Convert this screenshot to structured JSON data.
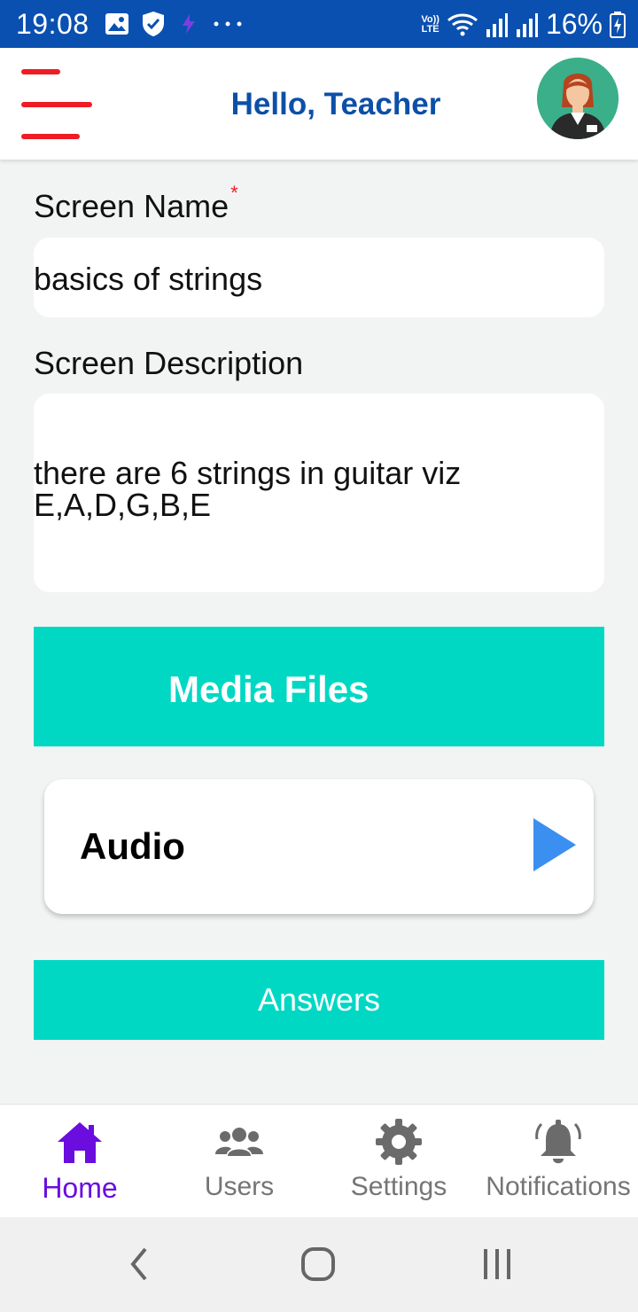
{
  "status_bar": {
    "time": "19:08",
    "battery_percent": "16%",
    "network_label_top": "Vo))",
    "network_label_bottom": "LTE",
    "icons": [
      "image-icon",
      "shield-icon",
      "app-icon",
      "more-dots-icon",
      "wifi-icon",
      "signal-icon",
      "signal-icon",
      "battery-icon"
    ]
  },
  "header": {
    "title": "Hello, Teacher",
    "menu_icon": "hamburger-menu-icon",
    "accent_color": "#ee1c25",
    "title_color": "#0d4fa8"
  },
  "form": {
    "screen_name_label": "Screen Name",
    "required_mark": "*",
    "screen_name_value": "basics of strings",
    "screen_description_label": "Screen Description",
    "screen_description_value": "there are 6 strings in guitar viz E,A,D,G,B,E"
  },
  "media": {
    "media_files_label": "Media Files",
    "audio_label": "Audio",
    "play_icon": "play-icon",
    "button_color": "#00d8c4"
  },
  "answers": {
    "label": "Answers"
  },
  "bottom_nav": {
    "items": [
      {
        "label": "Home",
        "icon": "home-icon",
        "active": true
      },
      {
        "label": "Users",
        "icon": "users-icon",
        "active": false
      },
      {
        "label": "Settings",
        "icon": "gear-icon",
        "active": false
      },
      {
        "label": "Notifications",
        "icon": "bell-icon",
        "active": false
      }
    ],
    "active_color": "#6a0dde"
  },
  "system_nav": {
    "icons": [
      "back-icon",
      "home-circle-icon",
      "recents-icon"
    ]
  }
}
